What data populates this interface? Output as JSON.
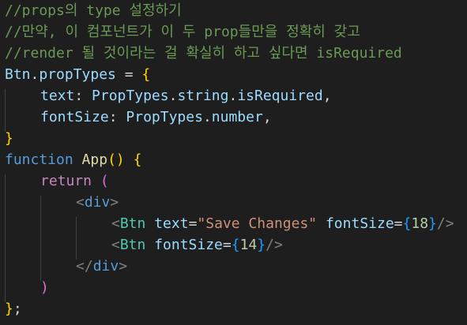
{
  "colors": {
    "background": "#1e1e1e",
    "comment": "#6a9955",
    "variable": "#9cdcfe",
    "keyword": "#569cd6",
    "control": "#c586c0",
    "function": "#dcdcaa",
    "component": "#4ec9b0",
    "string": "#ce9178",
    "number": "#b5cea8",
    "bracket1": "#ffd700",
    "bracket2": "#da70d6",
    "bracket3": "#179fff"
  },
  "code": {
    "l1": {
      "comment": "//props의 type 설정하기"
    },
    "l2": {
      "comment": "//만약, 이 컴포넌트가 이 두 prop들만을 정확히 갖고"
    },
    "l3": {
      "comment": "//render 될 것이라는 걸 확실히 하고 싶다면 isRequired"
    },
    "l4": {
      "obj": "Btn",
      "dot": ".",
      "prop": "propTypes",
      "eq": " = ",
      "brace": "{"
    },
    "l5": {
      "key": "text",
      "colon": ": ",
      "a": "PropTypes",
      "d1": ".",
      "b": "string",
      "d2": ".",
      "c": "isRequired",
      "comma": ","
    },
    "l6": {
      "key": "fontSize",
      "colon": ": ",
      "a": "PropTypes",
      "d1": ".",
      "b": "number",
      "comma": ","
    },
    "l7": {
      "brace": "}"
    },
    "l8": {
      "kw": "function",
      "sp": " ",
      "name": "App",
      "paren": "()",
      "sp2": " ",
      "brace": "{"
    },
    "l9": {
      "kw": "return",
      "sp": " ",
      "paren": "("
    },
    "l10": {
      "lt": "<",
      "tag": "div",
      "gt": ">"
    },
    "l11": {
      "lt": "<",
      "comp": "Btn",
      "sp": " ",
      "attr1": "text",
      "eq1": "=",
      "str": "\"Save Changes\"",
      "sp2": " ",
      "attr2": "fontSize",
      "eq2": "=",
      "ob": "{",
      "num": "18",
      "cb": "}",
      "close": "/>"
    },
    "l12": {
      "lt": "<",
      "comp": "Btn",
      "sp": " ",
      "attr": "fontSize",
      "eq": "=",
      "ob": "{",
      "num": "14",
      "cb": "}",
      "close": "/>"
    },
    "l13": {
      "lt": "</",
      "tag": "div",
      "gt": ">"
    },
    "l14": {
      "paren": ")"
    },
    "l15": {
      "brace": "}",
      "semi": ";"
    }
  }
}
